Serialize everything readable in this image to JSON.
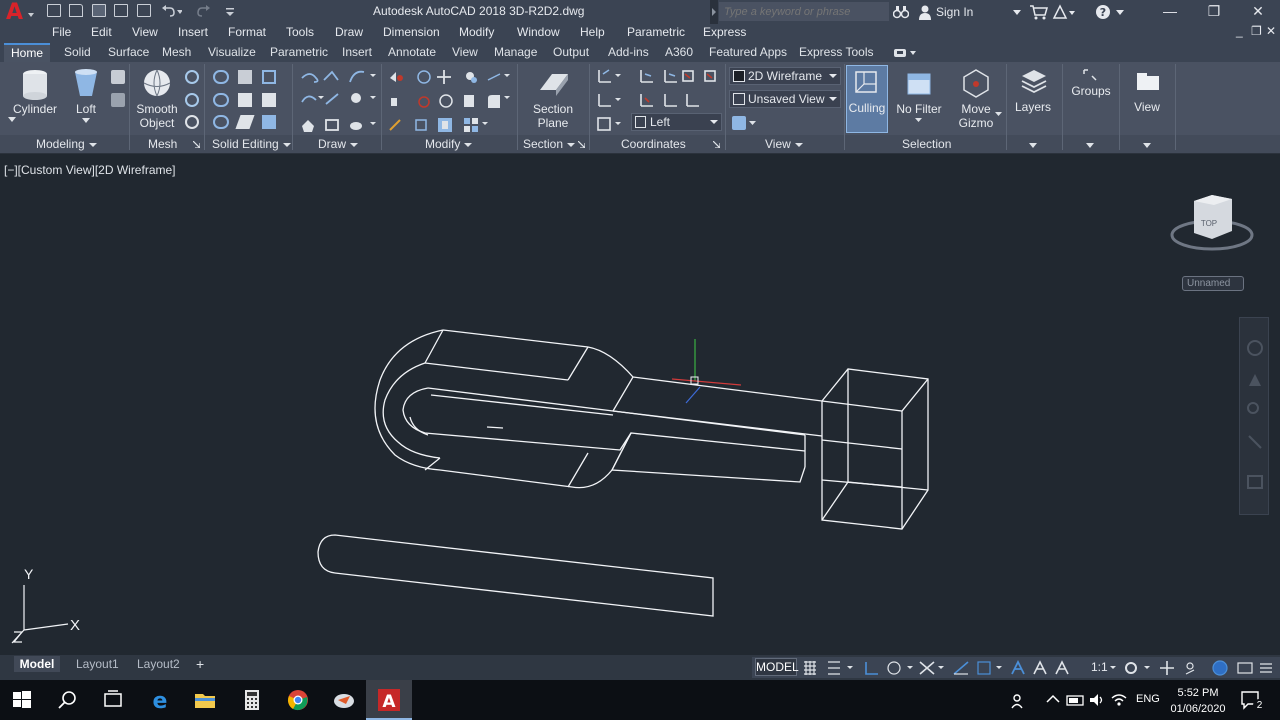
{
  "window": {
    "title": "Autodesk AutoCAD 2018   3D-R2D2.dwg",
    "search_placeholder": "Type a keyword or phrase",
    "sign_in": "Sign In",
    "minimize": "—",
    "restore": "❐",
    "close": "✕"
  },
  "menu": [
    "File",
    "Edit",
    "View",
    "Insert",
    "Format",
    "Tools",
    "Draw",
    "Dimension",
    "Modify",
    "Window",
    "Help",
    "Parametric",
    "Express"
  ],
  "ribbon_tabs": [
    "Home",
    "Solid",
    "Surface",
    "Mesh",
    "Visualize",
    "Parametric",
    "Insert",
    "Annotate",
    "View",
    "Manage",
    "Output",
    "Add-ins",
    "A360",
    "Featured Apps",
    "Express Tools"
  ],
  "ribbon": {
    "cylinder": "Cylinder",
    "loft": "Loft",
    "smooth_object_1": "Smooth",
    "smooth_object_2": "Object",
    "section_plane_1": "Section",
    "section_plane_2": "Plane",
    "visual_style": "2D Wireframe",
    "named_view": "Unsaved View",
    "ucs_view": "Left",
    "culling": "Culling",
    "no_filter": "No Filter",
    "move_gizmo_1": "Move",
    "move_gizmo_2": "Gizmo",
    "layers": "Layers",
    "groups": "Groups",
    "view": "View"
  },
  "panels": {
    "modeling": "Modeling",
    "mesh": "Mesh",
    "solid_editing": "Solid Editing",
    "draw": "Draw",
    "modify": "Modify",
    "section": "Section",
    "coordinates": "Coordinates",
    "view": "View",
    "selection": "Selection"
  },
  "viewport": {
    "label": "[−][Custom View][2D Wireframe]",
    "viewcube_top": "TOP",
    "viewcube_name": "Unnamed",
    "ucs_x": "X",
    "ucs_y": "Y"
  },
  "layout_tabs": [
    "Model",
    "Layout1",
    "Layout2"
  ],
  "add_layout": "+",
  "status": {
    "model": "MODEL",
    "scale": "1:1"
  },
  "taskbar": {
    "lang": "ENG",
    "time": "5:52 PM",
    "date": "01/06/2020",
    "notifications": "2"
  },
  "colors": {
    "accent": "#4b8fd8",
    "autocad_red": "#d8232a",
    "canvas": "#212830"
  }
}
